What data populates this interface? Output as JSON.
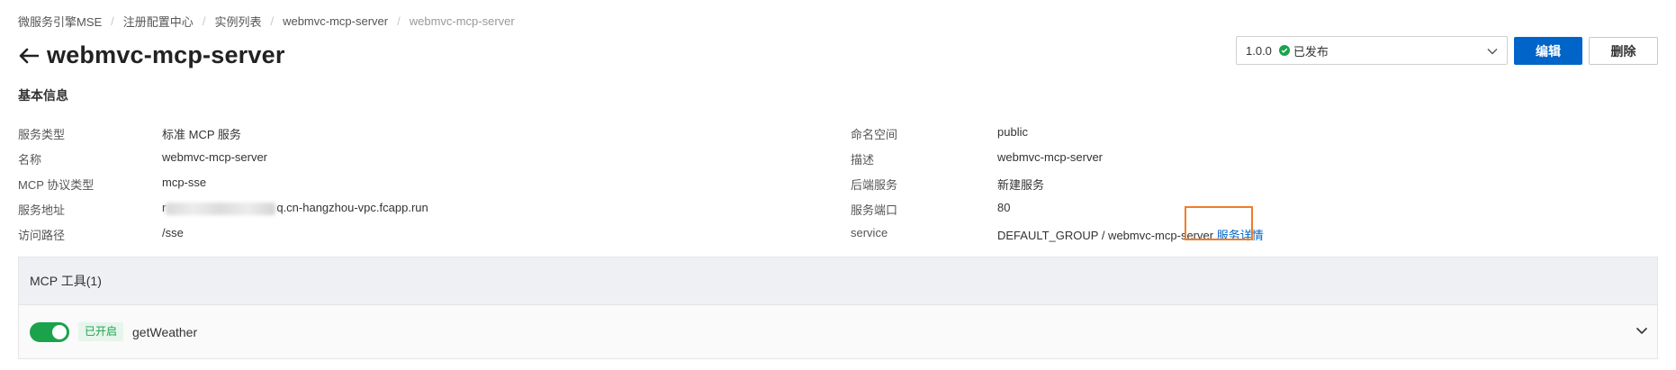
{
  "breadcrumb": [
    "微服务引擎MSE",
    "注册配置中心",
    "实例列表",
    "webmvc-mcp-server",
    "webmvc-mcp-server"
  ],
  "page_title": "webmvc-mcp-server",
  "version_select": {
    "version": "1.0.0",
    "status": "已发布"
  },
  "buttons": {
    "edit": "编辑",
    "delete": "删除"
  },
  "section_title": "基本信息",
  "left_info": [
    {
      "label": "服务类型",
      "value": "标准 MCP 服务"
    },
    {
      "label": "名称",
      "value": "webmvc-mcp-server"
    },
    {
      "label": "MCP 协议类型",
      "value": "mcp-sse"
    },
    {
      "label": "服务地址",
      "value_prefix": "r",
      "value_suffix": "q.cn-hangzhou-vpc.fcapp.run"
    },
    {
      "label": "访问路径",
      "value": "/sse"
    }
  ],
  "right_info": [
    {
      "label": "命名空间",
      "value": "public"
    },
    {
      "label": "描述",
      "value": "webmvc-mcp-server"
    },
    {
      "label": "后端服务",
      "value": "新建服务"
    },
    {
      "label": "服务端口",
      "value": "80"
    },
    {
      "label": "service",
      "value": "DEFAULT_GROUP / webmvc-mcp-server",
      "link": "服务详情"
    }
  ],
  "tools_panel": {
    "title": "MCP 工具(1)",
    "tools": [
      {
        "status": "已开启",
        "name": "getWeather",
        "enabled": true
      }
    ]
  },
  "colors": {
    "primary": "#0064c8",
    "success": "#1aa34a",
    "highlight": "#f07d28"
  }
}
